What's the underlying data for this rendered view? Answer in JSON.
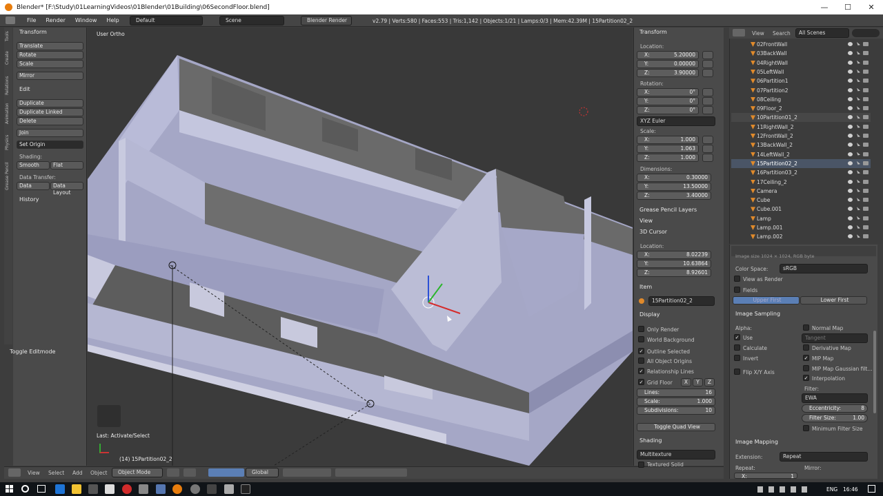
{
  "window": {
    "title": "Blender* [F:\\Study\\01LearningVideos\\01Blender\\01Building\\06SecondFloor.blend]",
    "minimize": "—",
    "maximize": "☐",
    "close": "✕"
  },
  "topbar": {
    "menus": [
      "File",
      "Render",
      "Window",
      "Help"
    ],
    "layout": "Default",
    "scene": "Scene",
    "engine": "Blender Render",
    "stats": "v2.79 | Verts:580 | Faces:553 | Tris:1,142 | Objects:1/21 | Lamps:0/3 | Mem:42.39M | 15Partition02_2"
  },
  "tools": {
    "vtabs": [
      "Tools",
      "Create",
      "Relations",
      "Animation",
      "Physics",
      "Grease Pencil"
    ],
    "transform_header": "Transform",
    "translate": "Translate",
    "rotate": "Rotate",
    "scale": "Scale",
    "mirror": "Mirror",
    "edit_header": "Edit",
    "duplicate": "Duplicate",
    "duplicate_linked": "Duplicate Linked",
    "delete": "Delete",
    "join": "Join",
    "set_origin": "Set Origin",
    "shading_label": "Shading:",
    "smooth": "Smooth",
    "flat": "Flat",
    "data_transfer_label": "Data Transfer:",
    "data": "Data",
    "data_layout": "Data Layout",
    "history": "History",
    "toggle_editmode": "Toggle Editmode"
  },
  "viewport": {
    "view_name": "User Ortho",
    "last_op": "Last: Activate/Select",
    "object_info": "(14) 15Partition02_2"
  },
  "bottombar": {
    "view": "View",
    "select": "Select",
    "add": "Add",
    "object": "Object",
    "mode": "Object Mode",
    "orientation": "Global"
  },
  "npanel": {
    "transform": "Transform",
    "location": "Location:",
    "loc": [
      {
        "k": "X:",
        "v": "5.20000"
      },
      {
        "k": "Y:",
        "v": "0.00000"
      },
      {
        "k": "Z:",
        "v": "3.90000"
      }
    ],
    "rotation": "Rotation:",
    "rot": [
      {
        "k": "X:",
        "v": "0°"
      },
      {
        "k": "Y:",
        "v": "0°"
      },
      {
        "k": "Z:",
        "v": "0°"
      }
    ],
    "rot_mode": "XYZ Euler",
    "scale_label": "Scale:",
    "scl": [
      {
        "k": "X:",
        "v": "1.000"
      },
      {
        "k": "Y:",
        "v": "1.063"
      },
      {
        "k": "Z:",
        "v": "1.000"
      }
    ],
    "dimensions": "Dimensions:",
    "dim": [
      {
        "k": "X:",
        "v": "0.30000"
      },
      {
        "k": "Y:",
        "v": "13.50000"
      },
      {
        "k": "Z:",
        "v": "3.40000"
      }
    ],
    "grease": "Grease Pencil Layers",
    "view": "View",
    "cursor": "3D Cursor",
    "cursor_loc": "Location:",
    "cur": [
      {
        "k": "X:",
        "v": "8.02239"
      },
      {
        "k": "Y:",
        "v": "10.63864"
      },
      {
        "k": "Z:",
        "v": "8.92601"
      }
    ],
    "item": "Item",
    "item_name": "15Partition02_2",
    "display": "Display",
    "only_render": "Only Render",
    "world_bg": "World Background",
    "outline_sel": "Outline Selected",
    "all_origins": "All Object Origins",
    "rel_lines": "Relationship Lines",
    "grid_floor": "Grid Floor",
    "gx": "X",
    "gy": "Y",
    "gz": "Z",
    "lines": {
      "k": "Lines:",
      "v": "16"
    },
    "scale": {
      "k": "Scale:",
      "v": "1.000"
    },
    "subdiv": {
      "k": "Subdivisions:",
      "v": "10"
    },
    "toggle_quad": "Toggle Quad View",
    "shading": "Shading",
    "shade_mode": "Multitexture",
    "textured_solid": "Textured Solid"
  },
  "outliner": {
    "view": "View",
    "search": "Search",
    "scenes": "All Scenes",
    "items": [
      "02FrontWall",
      "03BackWall",
      "04RightWall",
      "05LeftWall",
      "06Partition1",
      "07Partition2",
      "08Ceiling",
      "09Floor_2",
      "10Partition01_2",
      "11RightWall_2",
      "12FrontWall_2",
      "13BackWall_2",
      "14LeftWall_2",
      "15Partition02_2",
      "16Partition03_2",
      "17Ceiling_2",
      "Camera",
      "Cube",
      "Cube.001",
      "Lamp",
      "Lamp.001",
      "Lamp.002"
    ]
  },
  "props": {
    "cut_text": "Image size 1024 × 1024, RGB byte",
    "color_space_label": "Color Space:",
    "color_space": "sRGB",
    "view_as_render": "View as Render",
    "fields": "Fields",
    "upper_first": "Upper First",
    "lower_first": "Lower First",
    "image_sampling": "Image Sampling",
    "alpha": "Alpha:",
    "use": "Use",
    "calculate": "Calculate",
    "invert": "Invert",
    "flip_xy": "Flip X/Y Axis",
    "normal_map": "Normal Map",
    "tangent": "Tangent",
    "derivative_map": "Derivative Map",
    "mip_map": "MIP Map",
    "mip_gauss": "MIP Map Gaussian filt...",
    "interpolation": "Interpolation",
    "filter": "Filter:",
    "ewa": "EWA",
    "eccentricity": {
      "k": "Eccentricity:",
      "v": "8"
    },
    "filter_size": {
      "k": "Filter Size:",
      "v": "1.00"
    },
    "min_filter": "Minimum Filter Size",
    "image_mapping": "Image Mapping",
    "extension": "Extension:",
    "repeat_mode": "Repeat",
    "repeat": "Repeat:",
    "mirror": "Mirror:",
    "rx": "X:",
    "ry": "1"
  },
  "taskbar": {
    "lang": "ENG",
    "time": "16:46"
  }
}
